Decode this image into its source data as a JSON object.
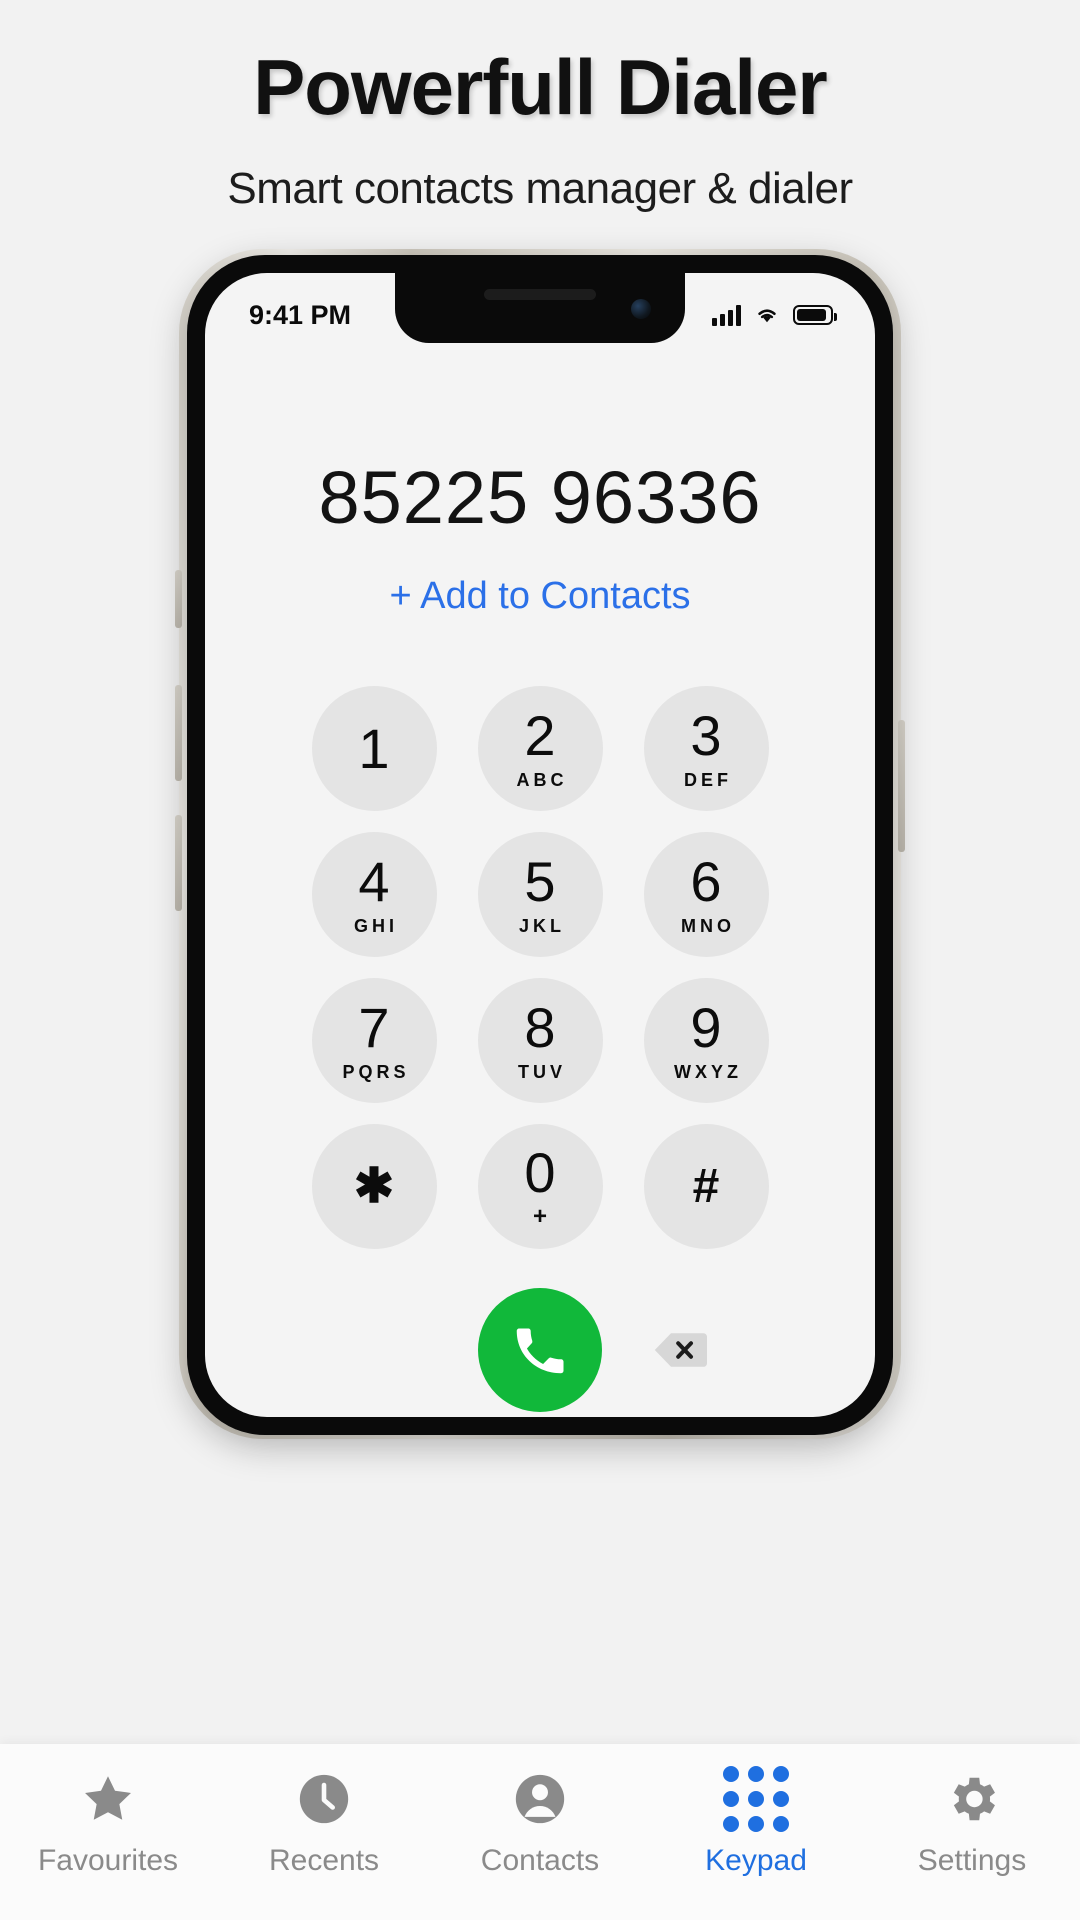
{
  "header": {
    "title": "Powerfull Dialer",
    "subtitle": "Smart contacts manager & dialer"
  },
  "phone": {
    "status_bar": {
      "time": "9:41 PM",
      "signal_icon": "cellular-signal-icon",
      "wifi_icon": "wifi-icon",
      "battery_icon": "battery-icon"
    },
    "dialer": {
      "number": "85225 96336",
      "add_to_contacts_label": "+ Add to Contacts",
      "keys": [
        {
          "digit": "1",
          "letters": ""
        },
        {
          "digit": "2",
          "letters": "ABC"
        },
        {
          "digit": "3",
          "letters": "DEF"
        },
        {
          "digit": "4",
          "letters": "GHI"
        },
        {
          "digit": "5",
          "letters": "JKL"
        },
        {
          "digit": "6",
          "letters": "MNO"
        },
        {
          "digit": "7",
          "letters": "PQRS"
        },
        {
          "digit": "8",
          "letters": "TUV"
        },
        {
          "digit": "9",
          "letters": "WXYZ"
        },
        {
          "digit": "✱",
          "letters": ""
        },
        {
          "digit": "0",
          "letters": "+"
        },
        {
          "digit": "#",
          "letters": ""
        }
      ],
      "call_button": {
        "icon": "phone-handset-icon",
        "color": "#11b83a"
      },
      "delete_button": {
        "icon": "backspace-icon"
      }
    }
  },
  "tabbar": {
    "items": [
      {
        "label": "Favourites",
        "icon": "star-icon",
        "active": false
      },
      {
        "label": "Recents",
        "icon": "clock-icon",
        "active": false
      },
      {
        "label": "Contacts",
        "icon": "person-icon",
        "active": false
      },
      {
        "label": "Keypad",
        "icon": "keypad-dots-icon",
        "active": true
      },
      {
        "label": "Settings",
        "icon": "gear-icon",
        "active": false
      }
    ],
    "active_color": "#1f6fe0",
    "inactive_color": "#8a8a8a"
  }
}
